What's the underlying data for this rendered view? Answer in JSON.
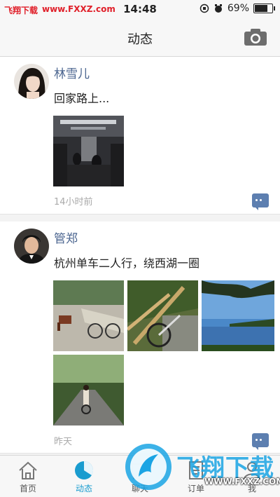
{
  "status": {
    "watermark_left": "飞翔下载",
    "watermark_url": "www.FXXZ.com",
    "time": "14:48",
    "battery_text": "69%",
    "battery_level": 0.69
  },
  "navbar": {
    "title": "动态"
  },
  "posts": [
    {
      "name": "林雪儿",
      "text": "回家路上...",
      "time": "14小时前"
    },
    {
      "name": "管郑",
      "text": "杭州单车二人行，绕西湖一圈",
      "time": "昨天"
    }
  ],
  "tabs": [
    {
      "label": "首页"
    },
    {
      "label": "动态"
    },
    {
      "label": "聊天"
    },
    {
      "label": "订单"
    },
    {
      "label": "我"
    }
  ],
  "watermark": {
    "brand": "飞翔下载",
    "url": "WWW.FXXZ.COM"
  },
  "colors": {
    "accent": "#1a9ccf",
    "name": "#4c6690",
    "comment": "#5d7fb0"
  }
}
